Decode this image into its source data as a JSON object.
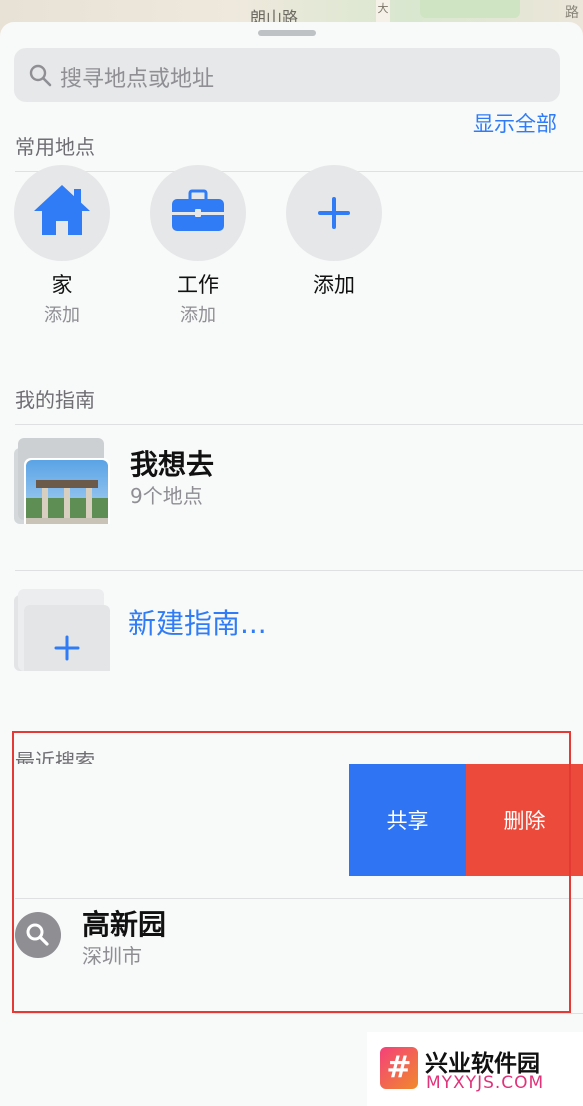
{
  "map": {
    "road_label": "朗山路",
    "road_label_right": "大",
    "edge_label": "路"
  },
  "search": {
    "placeholder": "搜寻地点或地址"
  },
  "favorites": {
    "header": "常用地点",
    "show_all": "显示全部",
    "items": [
      {
        "label": "家",
        "sub": "添加",
        "icon": "house-icon"
      },
      {
        "label": "工作",
        "sub": "添加",
        "icon": "briefcase-icon"
      },
      {
        "label": "添加",
        "sub": "",
        "icon": "plus-icon"
      }
    ]
  },
  "guides": {
    "header": "我的指南",
    "items": [
      {
        "title": "我想去",
        "sub": "9个地点"
      }
    ],
    "new_label": "新建指南..."
  },
  "recents": {
    "header": "最近搜索",
    "share_label": "共享",
    "delete_label": "删除",
    "items": [
      {
        "title": "高新园",
        "sub": "深圳市",
        "icon": "search-icon"
      }
    ]
  },
  "watermark": {
    "name": "兴业软件园",
    "url": "MYXYJS.COM",
    "logo_char": "#"
  },
  "colors": {
    "accent": "#2f7cf6",
    "share": "#2f74f2",
    "delete": "#ec4b3b",
    "highlight": "#e53935"
  }
}
